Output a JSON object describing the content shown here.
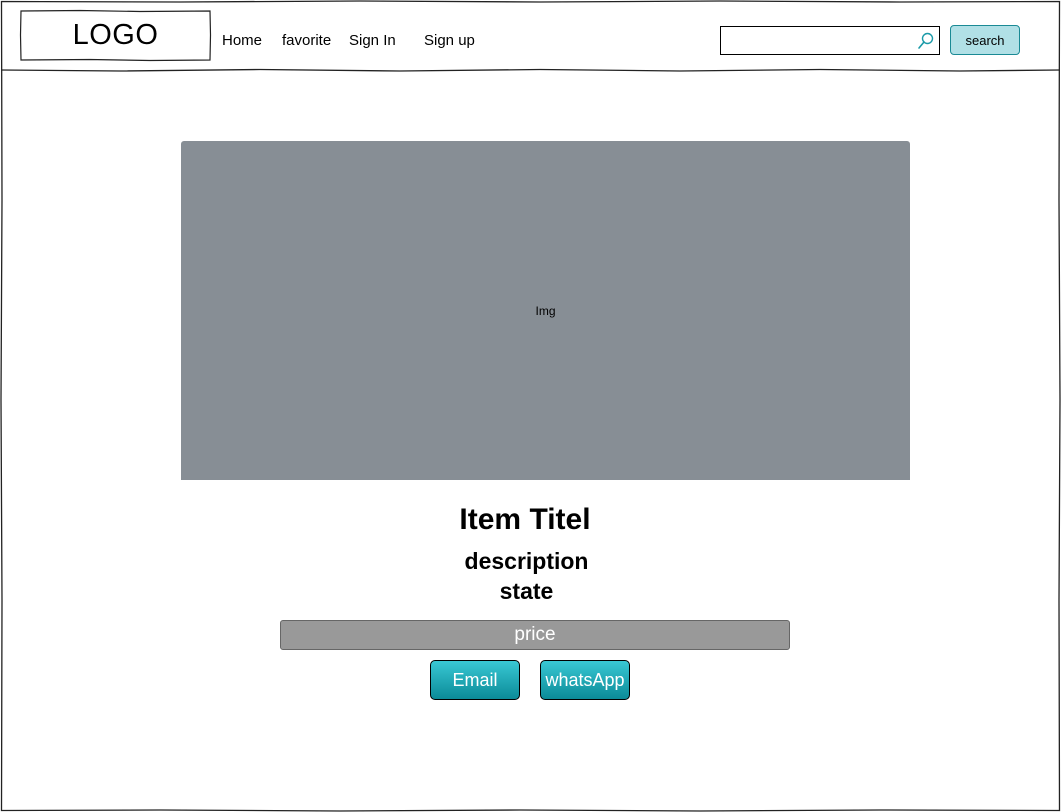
{
  "header": {
    "logo_text": "LOGO",
    "nav": [
      {
        "label": "Home"
      },
      {
        "label": "favorite"
      },
      {
        "label": "Sign In"
      },
      {
        "label": "Sign up"
      }
    ],
    "search": {
      "value": "",
      "placeholder": "",
      "button_label": "search"
    }
  },
  "item": {
    "image_label": "Img",
    "title": "Item Titel",
    "description": "description",
    "state": "state",
    "price": "price"
  },
  "actions": {
    "email_label": "Email",
    "whatsapp_label": "whatsApp"
  },
  "colors": {
    "accent": "#1a9aa8",
    "search_button_bg": "#b1e0e6",
    "image_placeholder": "#878e95",
    "price_bar": "#999999"
  }
}
